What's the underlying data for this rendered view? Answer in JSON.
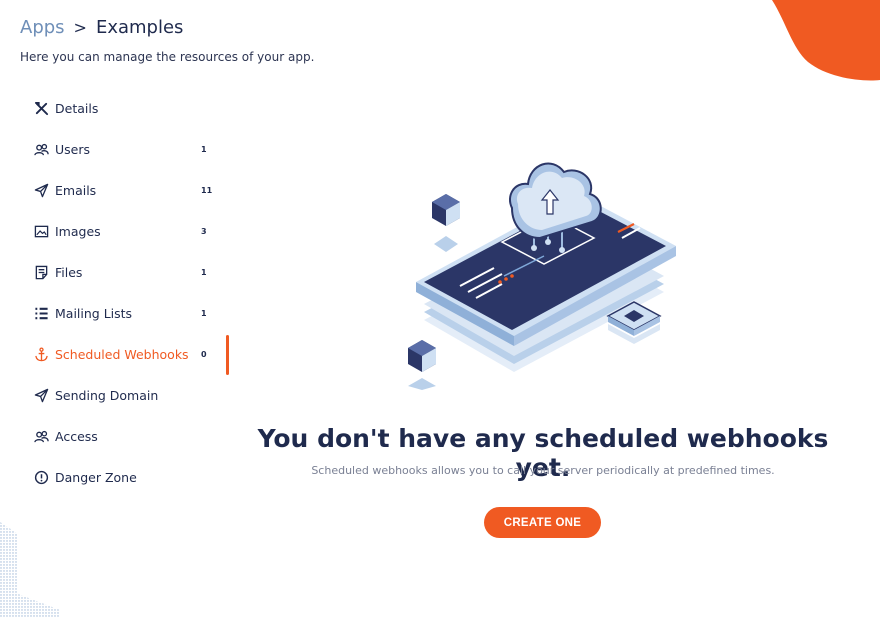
{
  "breadcrumb": {
    "root": "Apps",
    "separator": ">",
    "current": "Examples"
  },
  "subtitle": "Here you can manage the resources of your app.",
  "sidebar": {
    "items": [
      {
        "label": "Details",
        "icon": "tools-icon",
        "count": ""
      },
      {
        "label": "Users",
        "icon": "users-icon",
        "count": "1"
      },
      {
        "label": "Emails",
        "icon": "send-icon",
        "count": "11"
      },
      {
        "label": "Images",
        "icon": "image-icon",
        "count": "3"
      },
      {
        "label": "Files",
        "icon": "file-icon",
        "count": "1"
      },
      {
        "label": "Mailing Lists",
        "icon": "list-icon",
        "count": "1"
      },
      {
        "label": "Scheduled Webhooks",
        "icon": "anchor-icon",
        "count": "0",
        "active": true
      },
      {
        "label": "Sending Domain",
        "icon": "send-icon",
        "count": ""
      },
      {
        "label": "Access",
        "icon": "users-icon",
        "count": ""
      },
      {
        "label": "Danger Zone",
        "icon": "alert-circle-icon",
        "count": ""
      }
    ]
  },
  "empty_state": {
    "title": "You don't have any scheduled webhooks yet.",
    "description": "Scheduled webhooks allows you to call your server periodically at predefined times.",
    "button_label": "CREATE ONE"
  },
  "colors": {
    "accent": "#f05a22",
    "text": "#1f2a4d",
    "link": "#6f8fb8",
    "muted": "#7a8094"
  }
}
